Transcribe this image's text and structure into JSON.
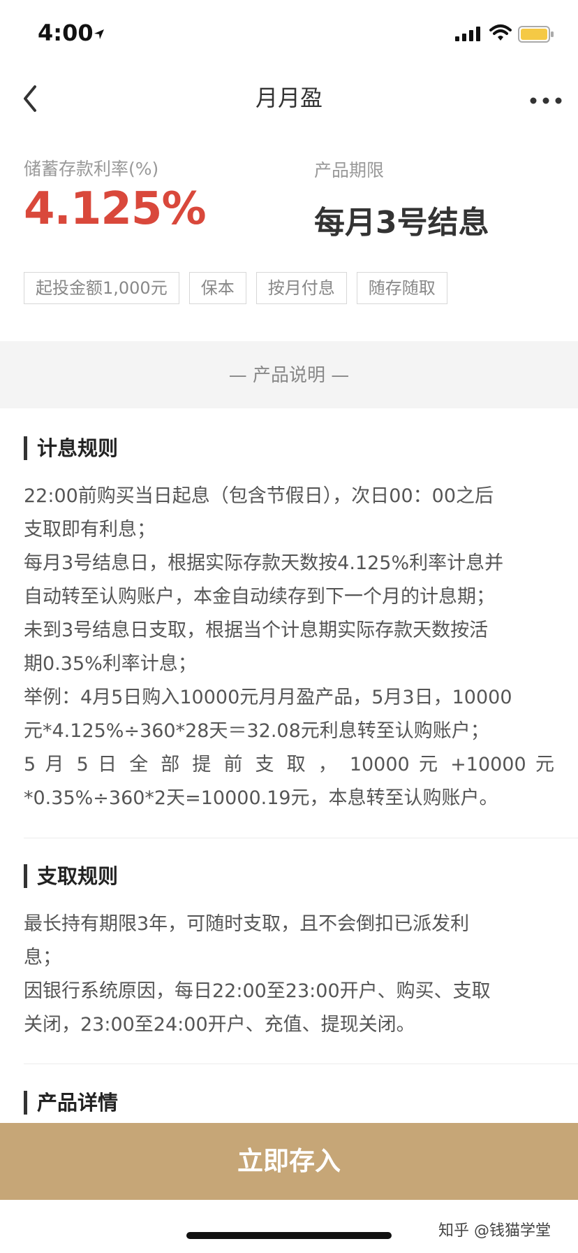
{
  "status_bar": {
    "time": "4:00"
  },
  "nav": {
    "title": "月月盈"
  },
  "summary": {
    "rate_label": "储蓄存款利率(%)",
    "rate_value": "4.125%",
    "term_label": "产品期限",
    "term_value": "每月3号结息",
    "tags": [
      "起投金额1,000元",
      "保本",
      "按月付息",
      "随存随取"
    ]
  },
  "section_title": "— 产品说明 —",
  "interest_rules": {
    "heading": "计息规则",
    "lines": [
      "22:00前购买当日起息（包含节假日），次日00：00之后",
      "支取即有利息；",
      "每月3号结息日，根据实际存款天数按4.125%利率计息并",
      "自动转至认购账户，本金自动续存到下一个月的计息期；",
      "未到3号结息日支取，根据当个计息期实际存款天数按活",
      "期0.35%利率计息；",
      "举例：4月5日购入10000元月月盈产品，5月3日，10000",
      "元*4.125%÷360*28天＝32.08元利息转至认购账户；",
      "5 月 5 日 全 部 提 前 支 取 ， 10000 元 +10000 元",
      "*0.35%÷360*2天=10000.19元，本息转至认购账户。"
    ]
  },
  "withdraw_rules": {
    "heading": "支取规则",
    "lines": [
      "最长持有期限3年，可随时支取，且不会倒扣已派发利",
      "息；",
      "因银行系统原因，每日22:00至23:00开户、购买、支取",
      "关闭，23:00至24:00开户、充值、提现关闭。"
    ]
  },
  "details": {
    "heading": "产品详情"
  },
  "cta": {
    "label": "立即存入"
  },
  "watermark": "知乎 @钱猫学堂",
  "colors": {
    "accent_red": "#d9483b",
    "cta_gold": "#c6a677",
    "battery_yellow": "#f5c945"
  },
  "icons": [
    "location-arrow-icon",
    "signal-icon",
    "wifi-icon",
    "battery-icon",
    "back-chevron-icon",
    "more-dots-icon"
  ]
}
